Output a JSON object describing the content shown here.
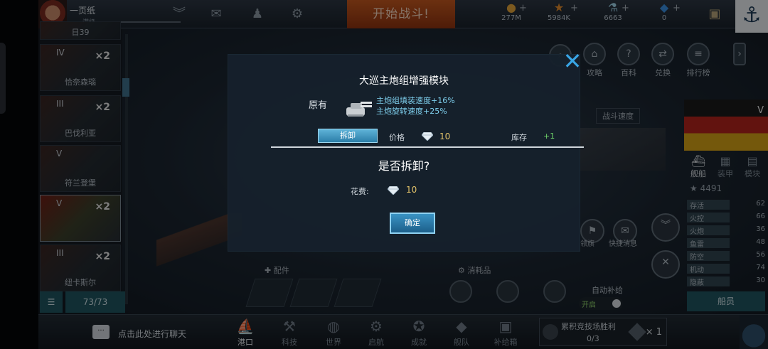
{
  "topbar": {
    "player_name": "一页纸",
    "player_level": "满级",
    "start_battle": "开始战斗!",
    "resources": [
      {
        "icon": "gold-coin-icon",
        "value": "277M"
      },
      {
        "icon": "star-icon",
        "value": "5984K"
      },
      {
        "icon": "fuel-icon",
        "value": "6663"
      },
      {
        "icon": "blue-gem-icon",
        "value": "0"
      }
    ]
  },
  "shiplist": {
    "partial_top_label": "日39",
    "ships": [
      {
        "tier": "IV",
        "count": "×2",
        "name": "恰奈森瑙"
      },
      {
        "tier": "III",
        "count": "×2",
        "name": "巴伐利亚"
      },
      {
        "tier": "V",
        "count": "",
        "name": "符兰登堡"
      },
      {
        "tier": "V",
        "count": "×2",
        "name": ""
      },
      {
        "tier": "III",
        "count": "×2",
        "name": "纽卡斯尔"
      }
    ],
    "page": "73/73"
  },
  "top_right_icons": [
    {
      "label": "攻略"
    },
    {
      "label": "百科"
    },
    {
      "label": "兑换"
    },
    {
      "label": "排行榜"
    }
  ],
  "mid": {
    "battle_label": "战斗速度",
    "parts_label": "配件",
    "consumables_label": "消耗品",
    "auto_supply": "自动补给",
    "toggle_on": "开启",
    "chat_flag": "领旗",
    "quick_message": "快捷消息"
  },
  "rightpanel": {
    "tier": "V",
    "tabs": [
      "舰船",
      "装甲",
      "模块"
    ],
    "power": "4491",
    "stats": [
      {
        "name": "存活",
        "value": "62"
      },
      {
        "name": "火控",
        "value": "66"
      },
      {
        "name": "火炮",
        "value": "36"
      },
      {
        "name": "鱼雷",
        "value": "48"
      },
      {
        "name": "防空",
        "value": "56"
      },
      {
        "name": "机动",
        "value": "74"
      },
      {
        "name": "隐蔽",
        "value": "30"
      }
    ],
    "ships_button": "船员"
  },
  "bottombar": {
    "chat_prompt": "点击此处进行聊天",
    "nav": [
      "港口",
      "科技",
      "世界",
      "启航",
      "成就",
      "舰队",
      "补给箱"
    ],
    "arena_title": "累积竞技场胜利",
    "arena_progress": "0/3",
    "arena_reward": "× 1"
  },
  "dialog": {
    "title": "大巡主炮组增强模块",
    "original_label": "原有",
    "effects": [
      "主炮组填装速度+16%",
      "主炮旋转速度+25%"
    ],
    "dismantle_tab": "拆卸",
    "price_label": "价格",
    "price_value": "10",
    "stock_label": "库存",
    "stock_value": "+1",
    "confirm_question": "是否拆卸?",
    "cost_label": "花费:",
    "cost_value": "10",
    "ok_button": "确定"
  },
  "colors": {
    "accent": "#39a6e6",
    "gold": "#e3c36a",
    "green": "#6fd36a",
    "start_button": "#c4581f"
  }
}
